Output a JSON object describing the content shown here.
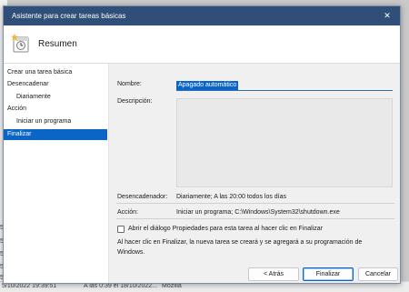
{
  "window": {
    "title": "Asistente para crear tareas básicas",
    "close_glyph": "✕"
  },
  "header": {
    "title": "Resumen",
    "icon": "task-wizard-icon"
  },
  "nav": {
    "items": [
      {
        "label": "Crear una tarea básica"
      },
      {
        "label": "Desencadenar"
      },
      {
        "label": "Diariamente"
      },
      {
        "label": "Acción"
      },
      {
        "label": "Iniciar un programa"
      },
      {
        "label": "Finalizar"
      }
    ],
    "active_index": 5
  },
  "form": {
    "name_label": "Nombre:",
    "name_value": "Apagado automático",
    "description_label": "Descripción:",
    "description_value": "",
    "trigger_label": "Desencadenador:",
    "trigger_value": "Diariamente; A las 20:00 todos los días",
    "action_label": "Acción:",
    "action_value": "Iniciar un programa; C:\\Windows\\System32\\shutdown.exe",
    "checkbox_label": "Abrir el diálogo Propiedades para esta tarea al hacer clic en Finalizar",
    "checkbox_checked": false,
    "info_line1": "Al hacer clic en Finalizar, la nueva tarea se creará y se agregará a su programación de",
    "info_line2": "Windows."
  },
  "buttons": {
    "back": "< Atrás",
    "finish": "Finalizar",
    "cancel": "Cancelar"
  },
  "background": {
    "row_date": "5/10/2022 19:39:51",
    "row_trigger": "A las 0:39 el 18/10/2022...",
    "row_author": "Mozilla",
    "left_ticks": [
      "5/",
      "5/",
      "5/",
      "5/",
      "5/"
    ]
  },
  "colors": {
    "titlebar": "#2f4f79",
    "selection": "#0a65c7"
  }
}
